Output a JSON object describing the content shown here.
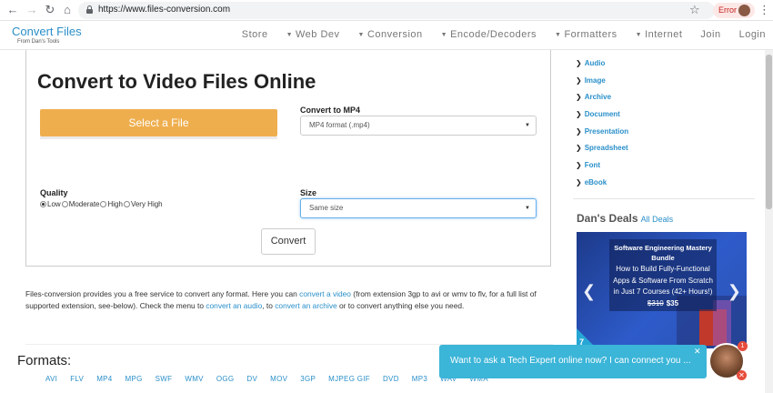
{
  "browser": {
    "url": "https://www.files-conversion.com",
    "error_label": "Error"
  },
  "header": {
    "brand": "Convert Files",
    "brand_sub": "From Dan's Tools",
    "nav": [
      {
        "label": "Store",
        "caret": false
      },
      {
        "label": "Web Dev",
        "caret": true
      },
      {
        "label": "Conversion",
        "caret": true
      },
      {
        "label": "Encode/Decoders",
        "caret": true
      },
      {
        "label": "Formatters",
        "caret": true
      },
      {
        "label": "Internet",
        "caret": true
      },
      {
        "label": "Join",
        "caret": false
      },
      {
        "label": "Login",
        "caret": false
      }
    ]
  },
  "main": {
    "title": "Convert to Video Files Online",
    "select_file_label": "Select a File",
    "convert_to_label": "Convert to MP4",
    "convert_to_value": "MP4 format (.mp4)",
    "quality_label": "Quality",
    "quality_options": [
      "Low",
      "Moderate",
      "High",
      "Very High"
    ],
    "quality_selected": "Low",
    "size_label": "Size",
    "size_value": "Same size",
    "convert_button": "Convert"
  },
  "description": {
    "t1": "Files-conversion provides you a free service to convert any format. Here you can ",
    "l1": "convert a video",
    "t2": " (from extension 3gp to avi or wmv to flv, for a full list of supported extension, see-below). Check the menu to ",
    "l2": "convert an audio",
    "t3": ", to ",
    "l3": "convert an archive",
    "t4": " or to convert anything else you need."
  },
  "formats": {
    "title": "Formats:",
    "items": [
      "AVI",
      "FLV",
      "MP4",
      "MPG",
      "SWF",
      "WMV",
      "OGG",
      "DV",
      "MOV",
      "3GP",
      "MJPEG GIF",
      "DVD",
      "MP3",
      "WAV",
      "WMA"
    ]
  },
  "sidebar": {
    "categories": [
      "Audio",
      "Image",
      "Archive",
      "Document",
      "Presentation",
      "Spreadsheet",
      "Font",
      "eBook"
    ],
    "deals_title": "Dan's Deals",
    "deals_link": "All Deals",
    "deal": {
      "name": "Software Engineering Mastery Bundle",
      "description": "How to Build Fully-Functional Apps & Software From Scratch in Just 7 Courses (42+ Hours!)",
      "old_price": "$310",
      "new_price": "$35",
      "number": "7"
    }
  },
  "chat": {
    "message": "Want to ask a Tech Expert online now? I can connect you ...",
    "badge": "1"
  },
  "colors": {
    "accent": "#2a8fc9",
    "select_button": "#efae4e",
    "chat": "#3bb5d8"
  }
}
